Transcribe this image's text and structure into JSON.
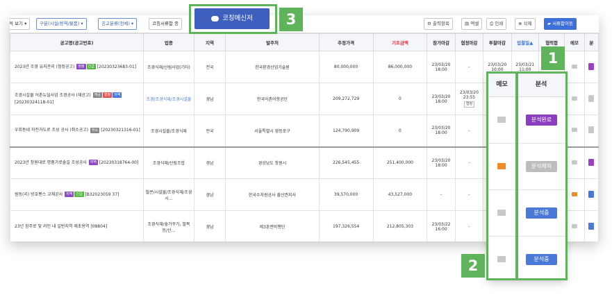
{
  "toolbar": {
    "view_label": "씩 보기",
    "division_label": "구분(시설/용역/물품)",
    "category_label": "공고분류(전체)",
    "filter_label": "코칭서류함 종",
    "export_label": "출력항목",
    "excel_label": "엑셀",
    "print_label": "인쇄",
    "delete_label": "삭제",
    "move_label": "서류함이동"
  },
  "columns": [
    "공고명(공고번호)",
    "업종",
    "지역",
    "발주처",
    "추정가격",
    "기초금액",
    "참가마감",
    "협정마감",
    "투찰마감",
    "입찰일▲",
    "협력함",
    "메모",
    "분"
  ],
  "rows": [
    {
      "name": "2023년 조경 유지관리 (정정공고)",
      "tags": [
        "정정",
        "긴급"
      ],
      "number": "[20230323683-01]",
      "industry": "조경식재/산림사업(기타)",
      "region": "전국",
      "agency": "한국환경산업기술원",
      "estimate": "80,000,000",
      "base": "86,000,000",
      "join": "23/03/20 18:00",
      "agree": "-",
      "bid": "23/03/20 10:00",
      "open": "23/03/21 11:00",
      "faded": false
    },
    {
      "name": "조경시설물 어촌뉴딜사업 조경공사 (재공고)",
      "tags": [
        "재공",
        "협정",
        "지역"
      ],
      "number": "[20230324118-01]",
      "industry": "조경/조경식재/조경시설물",
      "region": "경남",
      "agency": "한국어촌어항공단",
      "estimate": "209,272,729",
      "base": "0",
      "join": "23/03/20 18:00",
      "agree": "23/03/20 23:55",
      "bid": "",
      "open": "",
      "faded": true
    },
    {
      "name": "우회동네 자전거도로 조성 공사 (취소공고)",
      "tags": [
        "취소"
      ],
      "number": "[20230321316-01]",
      "industry": "조경시설물/조경식재",
      "region": "전국",
      "agency": "서울특별시 영등포구",
      "estimate": "124,790,909",
      "base": "0",
      "join": "23/03/20 18:00",
      "agree": "-",
      "bid": "",
      "open": "",
      "faded": true
    },
    {
      "name": "2023년 창원대로 명품가로숲길 조성공사",
      "tags": [
        "지역"
      ],
      "number": "[20230318764-00]",
      "industry": "조경식재/산림조합",
      "region": "경남",
      "agency": "경상남도 창원시",
      "estimate": "226,545,455",
      "base": "251,400,000",
      "join": "23/03/20 18:00",
      "agree": "-",
      "bid": "",
      "open": "",
      "faded": false
    },
    {
      "name": "원동(리) 방호펜스 교체공사",
      "tags": [
        "지역",
        "긴급"
      ],
      "number": "[B32023059 37]",
      "industry": "철콘/시설물/조경식재/조경시...",
      "region": "경남",
      "agency": "한국수자원공사 출산권지사",
      "estimate": "39,570,000",
      "base": "43,527,000",
      "join": "-",
      "agree": "-",
      "bid": "",
      "open": "",
      "faded": false
    },
    {
      "name": "23년 함주로 및 라인 내 일반지역 제초용역",
      "tags": [],
      "number": "[08804]",
      "industry": "조경식재/숲가꾸기, 벌목등/산...",
      "region": "경남",
      "agency": "제3훈련비행단",
      "estimate": "197,326,554",
      "base": "212,805,303",
      "join": "23/03/22 16:00",
      "agree": "-",
      "bid": "",
      "open": "",
      "faded": false
    }
  ],
  "zoom": {
    "memo_header": "메모",
    "analysis_header": "분석",
    "analysis_items": [
      "분석완료",
      "분석제외",
      "분석중",
      "분석중"
    ],
    "memo_states": [
      "grey",
      "orange",
      "grey",
      "grey"
    ]
  },
  "coach_button_label": "코칭메신저",
  "badges": [
    "1",
    "2",
    "3"
  ],
  "colors": {
    "accent": "#3f5fbf",
    "highlight": "#5fb35b",
    "done": "#8b3fc0",
    "excluded": "#bdbdbd",
    "progress": "#4a79d8",
    "price_red": "#e0313b"
  }
}
